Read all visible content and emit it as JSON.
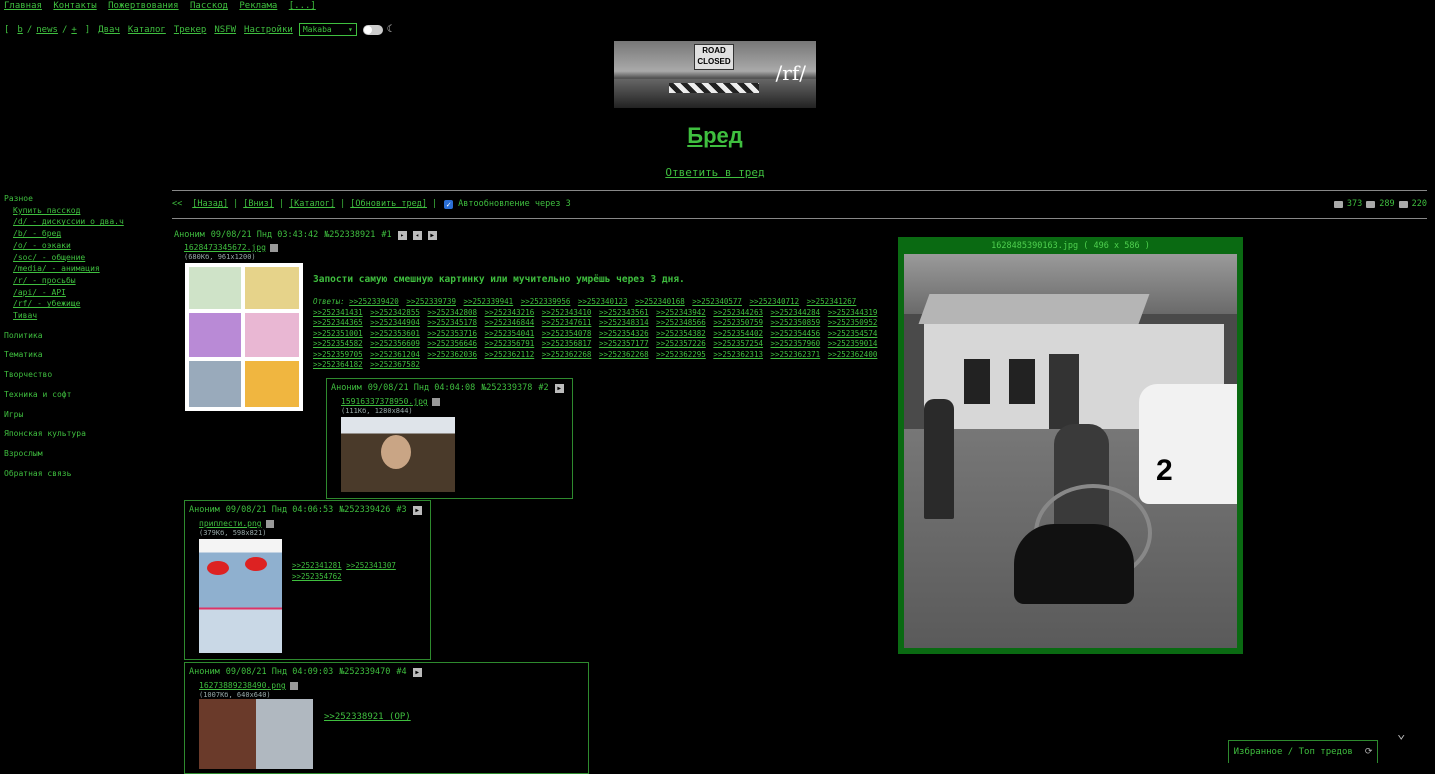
{
  "topnav": [
    "Главная",
    "Контакты",
    "Пожертвования",
    "Пасскод",
    "Реклама",
    "[...]"
  ],
  "boardnav": {
    "open": "[",
    "items": [
      "b",
      "news",
      "+"
    ],
    "close": "]",
    "extra": [
      "Двач",
      "Каталог",
      "Трекер",
      "NSFW",
      "Настройки"
    ],
    "style_value": "Makaba"
  },
  "banner": {
    "sign": "ROAD CLOSED",
    "board": "/rf/"
  },
  "thread_title": "Бред",
  "reply_link": "Ответить в тред",
  "sidebar": {
    "groups": [
      {
        "label": "Разное",
        "items": [
          "Купить пасскод",
          "/d/ - дискуссии о два.ч",
          "/b/ - бред",
          "/o/ - оэкаки",
          "/soc/ - общение",
          "/media/ - анимация",
          "/r/ - просьбы",
          "/api/ - API",
          "/rf/ - убежище",
          "Тивач"
        ]
      },
      {
        "label": "Политика",
        "items": []
      },
      {
        "label": "Тематика",
        "items": []
      },
      {
        "label": "Творчество",
        "items": []
      },
      {
        "label": "Техника и софт",
        "items": []
      },
      {
        "label": "Игры",
        "items": []
      },
      {
        "label": "Японская культура",
        "items": []
      },
      {
        "label": "Взрослым",
        "items": []
      },
      {
        "label": "Обратная связь",
        "items": []
      }
    ]
  },
  "threadnav": {
    "back_arrows": "<<",
    "items": [
      "[Назад]",
      "[Вниз]",
      "[Каталог]",
      "[Обновить тред]"
    ],
    "auto": "Автообновление через 3"
  },
  "stats": {
    "posts": "373",
    "files": "289",
    "users": "220"
  },
  "op": {
    "author": "Аноним",
    "date": "09/08/21 Пнд 03:43:42",
    "num": "№252338921",
    "idx": "#1",
    "file": "16284733456??.jpg",
    "file_display": "1628473345672.jpg",
    "meta": "(680Кб, 961x1200)",
    "text": "Запости самую смешную картинку или мучительно умрёшь через 3 дня.",
    "answers_label": "Ответы:",
    "answers": [
      ">>252339420",
      ">>252339739",
      ">>252339941",
      ">>252339956",
      ">>252340123",
      ">>252340168",
      ">>252340577",
      ">>252340712",
      ">>252341267",
      ">>252341431",
      ">>252342855",
      ">>252342808",
      ">>252343216",
      ">>252343410",
      ">>252343561",
      ">>252343942",
      ">>252344263",
      ">>252344284",
      ">>252344319",
      ">>252344365",
      ">>252344904",
      ">>252345178",
      ">>252346844",
      ">>252347611",
      ">>252348314",
      ">>252348566",
      ">>252350759",
      ">>252350859",
      ">>252350952",
      ">>252351001",
      ">>252353601",
      ">>252353716",
      ">>252354041",
      ">>252354078",
      ">>252354326",
      ">>252354382",
      ">>252354402",
      ">>252354456",
      ">>252354574",
      ">>252354582",
      ">>252356609",
      ">>252356646",
      ">>252356791",
      ">>252356817",
      ">>252357177",
      ">>252357226",
      ">>252357254",
      ">>252357960",
      ">>252359014",
      ">>252359705",
      ">>252361204",
      ">>252362036",
      ">>252362112",
      ">>252362268",
      ">>252362268",
      ">>252362295",
      ">>252362313",
      ">>252362371",
      ">>252362400",
      ">>252364182",
      ">>252367582"
    ]
  },
  "posts": [
    {
      "author": "Аноним",
      "date": "09/08/21 Пнд 04:04:08",
      "num": "№252339378",
      "idx": "#2",
      "file": "15916337378950.jpg",
      "meta": "(111Кб, 1280x844)",
      "links": []
    },
    {
      "author": "Аноним",
      "date": "09/08/21 Пнд 04:06:53",
      "num": "№252339426",
      "idx": "#3",
      "file": "приплести.png",
      "meta": "(379Кб, 598x821)",
      "links": [
        ">>252341281",
        ">>252341307",
        ">>252354762"
      ]
    },
    {
      "author": "Аноним",
      "date": "09/08/21 Пнд 04:09:03",
      "num": "№252339470",
      "idx": "#4",
      "file": "16273889238490.png",
      "meta": "(1007Кб, 640x640)",
      "links": [
        ">>252338921 (OP)"
      ]
    }
  ],
  "popup": {
    "caption": "1628485390163.jpg ( 496 x 586 )"
  },
  "favbar": "Избранное / Топ тредов",
  "icons": [
    "refresh-icon",
    "chevron-down-icon",
    "comment-icon",
    "image-icon",
    "users-icon",
    "moon-icon"
  ]
}
